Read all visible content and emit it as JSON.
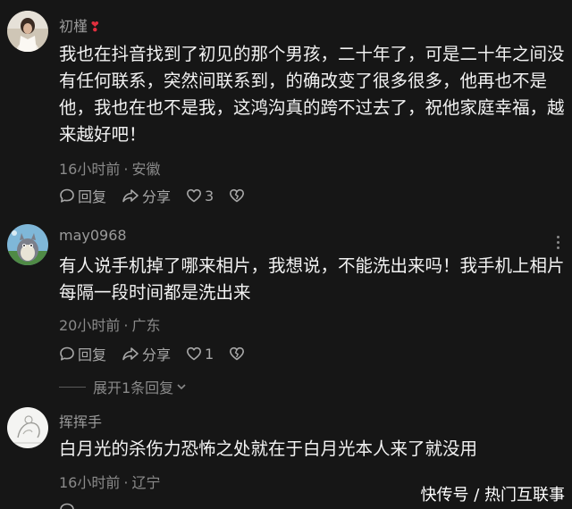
{
  "comments": [
    {
      "username": "初槿",
      "badge": "❣",
      "text": "我也在抖音找到了初见的那个男孩，二十年了，可是二十年之间没有任何联系，突然间联系到，的确改变了很多很多，他再也不是他，我也在也不是我，这鸿沟真的跨不过去了，祝他家庭幸福，越来越好吧！",
      "time": "16小时前",
      "separator": "·",
      "location": "安徽",
      "reply_label": "回复",
      "share_label": "分享",
      "likes": "3"
    },
    {
      "username": "may0968",
      "text": "有人说手机掉了哪来相片，我想说，不能洗出来吗！我手机上相片每隔一段时间都是洗出来",
      "time": "20小时前",
      "separator": "·",
      "location": "广东",
      "reply_label": "回复",
      "share_label": "分享",
      "likes": "1",
      "expand_label": "展开1条回复"
    },
    {
      "username": "挥挥手",
      "text": "白月光的杀伤力恐怖之处就在于白月光本人来了就没用",
      "time": "16小时前",
      "separator": "·",
      "location": "辽宁"
    }
  ],
  "watermark": "快传号 / 热门互联事",
  "icons": {
    "reply": "comment-bubble-icon",
    "share": "share-arrow-icon",
    "like": "heart-outline-icon",
    "dislike": "broken-heart-icon",
    "more": "more-dots-icon",
    "expand": "chevron-down-icon"
  }
}
